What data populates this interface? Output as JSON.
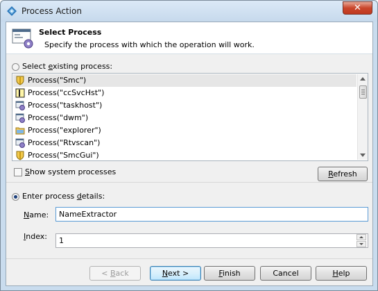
{
  "window": {
    "title": "Process Action",
    "close_glyph": "✕"
  },
  "header": {
    "title": "Select Process",
    "subtitle": "Specify the process with which the operation will work."
  },
  "existing": {
    "radio_label_pre": "Select ",
    "radio_label_u": "e",
    "radio_label_post": "xisting process:",
    "selected": false
  },
  "processes": [
    {
      "label": "Process(\"Smc\")",
      "icon": "shield-icon",
      "selected": true
    },
    {
      "label": "Process(\"ccSvcHst\")",
      "icon": "key-icon",
      "selected": false
    },
    {
      "label": "Process(\"taskhost\")",
      "icon": "gear-app-icon",
      "selected": false
    },
    {
      "label": "Process(\"dwm\")",
      "icon": "gear-app-icon",
      "selected": false
    },
    {
      "label": "Process(\"explorer\")",
      "icon": "folder-icon",
      "selected": false
    },
    {
      "label": "Process(\"Rtvscan\")",
      "icon": "gear-app-icon",
      "selected": false
    },
    {
      "label": "Process(\"SmcGui\")",
      "icon": "shield-icon",
      "selected": false
    }
  ],
  "show_system": {
    "label_pre": "",
    "label_u": "S",
    "label_post": "how system processes",
    "checked": false
  },
  "refresh_button": {
    "label_u": "R",
    "label_post": "efresh"
  },
  "details": {
    "radio_label_pre": "Enter process ",
    "radio_label_u": "d",
    "radio_label_post": "etails:",
    "selected": true,
    "name_label_u": "N",
    "name_label_post": "ame:",
    "name_value": "NameExtractor",
    "index_label_u": "I",
    "index_label_post": "ndex:",
    "index_value": "1"
  },
  "buttons": {
    "back": {
      "label": "< ",
      "label_u": "B",
      "label_post": "ack",
      "enabled": false
    },
    "next": {
      "label_u": "N",
      "label_post": "ext >"
    },
    "finish": {
      "label_u": "F",
      "label_post": "inish"
    },
    "cancel": {
      "label": "Cancel"
    },
    "help": {
      "label_u": "H",
      "label_post": "elp"
    }
  }
}
